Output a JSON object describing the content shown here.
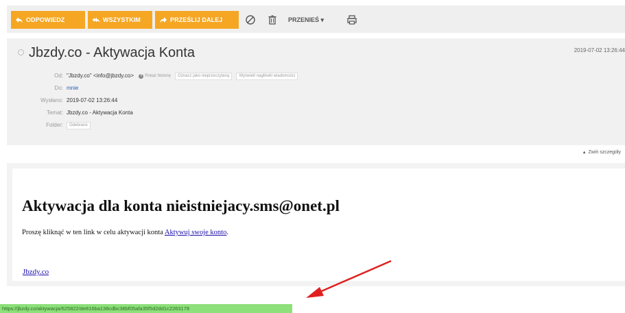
{
  "toolbar": {
    "reply_label": "ODPOWIEDZ",
    "reply_all_label": "WSZYSTKIM",
    "forward_label": "PRZEŚLIJ DALEJ",
    "move_label": "PRZENIEŚ ▾",
    "accent_color": "#f5a623"
  },
  "message": {
    "subject": "Jbzdy.co - Aktywacja Konta",
    "date_short": "2019-07-02 13:26:44",
    "from_label": "Od:",
    "from_value": "\"Jbzdy.co\" <info@jbzdy.co>",
    "show_history": "Pokaż historię",
    "mark_unread": "Oznacz jako nieprzeczytaną",
    "show_headers": "Wyświetl nagłówki wiadomości",
    "to_label": "Do:",
    "to_value": "mnie",
    "sent_label": "Wysłano:",
    "sent_value": "2019-07-02 13:26:44",
    "subject_label": "Temat:",
    "subject_value": "Jbzdy.co - Aktywacja Konta",
    "folder_label": "Folder:",
    "folder_value": "Odebrane",
    "collapse_label": "Zwiń szczegóły"
  },
  "body": {
    "heading": "Aktywacja dla konta nieistniejacy.sms@onet.pl",
    "text": "Proszę kliknąć w ten link w celu aktywacji konta ",
    "link_text": "Aktywuj swoje konto",
    "text_end": ".",
    "site_link": "Jbzdy.co"
  },
  "status_bar": {
    "url": "https://jbzdy.co/aktywacja/625822/de816ba138cdbc38bf05afa35f5d2dd1c2263178"
  },
  "annotation": {
    "arrow_color": "#e02020"
  }
}
